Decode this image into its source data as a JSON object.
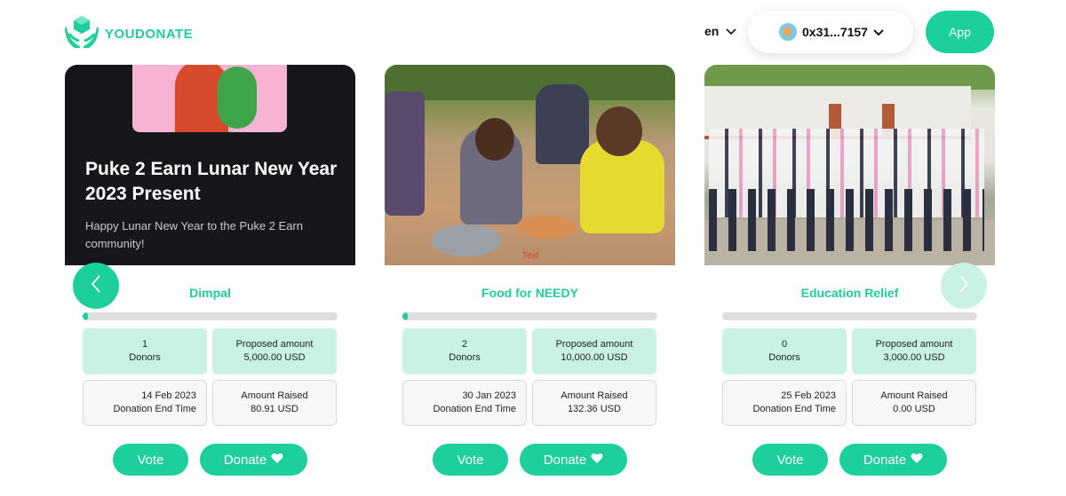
{
  "header": {
    "logo_text": "YOUDONATE",
    "language": "en",
    "wallet_address": "0x31...7157",
    "app_button": "App"
  },
  "colors": {
    "accent": "#1ccf9c",
    "accent_light": "#c9f2e3",
    "dark": "#16171a"
  },
  "cards": [
    {
      "promo_title": "Puke 2 Earn Lunar New Year 2023 Present",
      "promo_subtitle": "Happy Lunar New Year to the Puke 2 Earn community!",
      "title": "Dimpal",
      "progress_fraction": 0.02,
      "donors_count": "1",
      "donors_label": "Donors",
      "proposed_label": "Proposed amount",
      "proposed_amount": "5,000.00 USD",
      "end_date": "14 Feb 2023",
      "end_label": "Donation End Time",
      "raised_label": "Amount Raised",
      "raised_amount": "80.91 USD",
      "vote_label": "Vote",
      "donate_label": "Donate"
    },
    {
      "image_caption": "Text",
      "title": "Food for NEEDY",
      "progress_fraction": 0.013,
      "donors_count": "2",
      "donors_label": "Donors",
      "proposed_label": "Proposed amount",
      "proposed_amount": "10,000.00 USD",
      "end_date": "30 Jan 2023",
      "end_label": "Donation End Time",
      "raised_label": "Amount Raised",
      "raised_amount": "132.36 USD",
      "vote_label": "Vote",
      "donate_label": "Donate"
    },
    {
      "title": "Education Relief",
      "progress_fraction": 0.0,
      "donors_count": "0",
      "donors_label": "Donors",
      "proposed_label": "Proposed amount",
      "proposed_amount": "3,000.00 USD",
      "end_date": "25 Feb 2023",
      "end_label": "Donation End Time",
      "raised_label": "Amount Raised",
      "raised_amount": "0.00 USD",
      "vote_label": "Vote",
      "donate_label": "Donate"
    }
  ],
  "icons": {
    "logo": "hands-cube-icon",
    "language_chevron": "chevron-down-icon",
    "wallet_chevron": "chevron-down-icon",
    "prev": "chevron-left-icon",
    "next": "chevron-right-icon",
    "donate": "heart-icon"
  }
}
